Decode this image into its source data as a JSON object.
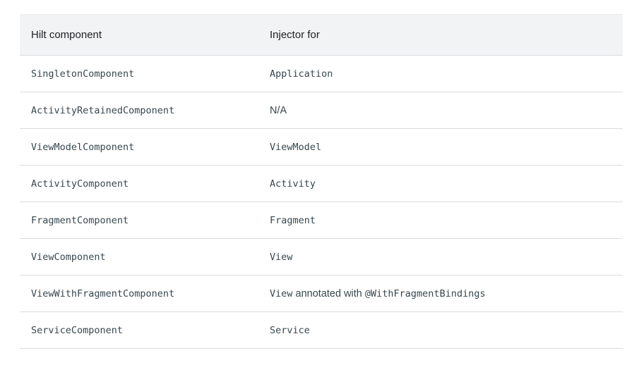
{
  "table": {
    "headers": {
      "component": "Hilt component",
      "injector": "Injector for"
    },
    "rows": [
      {
        "component": "SingletonComponent",
        "injector_code": "Application",
        "injector_text": "",
        "injector_code2": ""
      },
      {
        "component": "ActivityRetainedComponent",
        "injector_code": "N/A",
        "injector_text": "",
        "injector_code2": ""
      },
      {
        "component": "ViewModelComponent",
        "injector_code": "ViewModel",
        "injector_text": "",
        "injector_code2": ""
      },
      {
        "component": "ActivityComponent",
        "injector_code": "Activity",
        "injector_text": "",
        "injector_code2": ""
      },
      {
        "component": "FragmentComponent",
        "injector_code": "Fragment",
        "injector_text": "",
        "injector_code2": ""
      },
      {
        "component": "ViewComponent",
        "injector_code": "View",
        "injector_text": "",
        "injector_code2": ""
      },
      {
        "component": "ViewWithFragmentComponent",
        "injector_code": "View",
        "injector_text": " annotated with ",
        "injector_code2": "@WithFragmentBindings"
      },
      {
        "component": "ServiceComponent",
        "injector_code": "Service",
        "injector_text": "",
        "injector_code2": ""
      }
    ]
  }
}
